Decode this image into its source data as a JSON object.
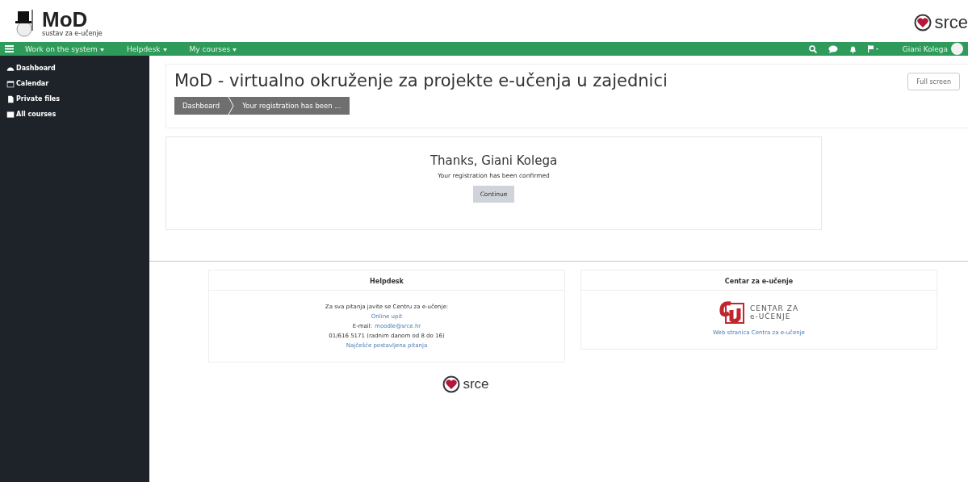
{
  "header": {
    "logo_title": "MoD",
    "logo_subtitle": "sustav za e-učenje",
    "partner_logo": "srce"
  },
  "navbar": {
    "menus": [
      {
        "label": "Work on the system"
      },
      {
        "label": "Helpdesk"
      },
      {
        "label": "My courses"
      }
    ],
    "user_name": "Giani Kolega"
  },
  "sidebar": {
    "items": [
      {
        "label": "Dashboard"
      },
      {
        "label": "Calendar"
      },
      {
        "label": "Private files"
      },
      {
        "label": "All courses"
      }
    ]
  },
  "page_header": {
    "title": "MoD - virtualno okruženje za projekte e-učenja u zajednici",
    "breadcrumbs": [
      "Dashboard",
      "Your registration has been ..."
    ],
    "full_screen_button": "Full screen"
  },
  "confirmation": {
    "heading": "Thanks, Giani Kolega",
    "message": "Your registration has been confirmed",
    "button": "Continue"
  },
  "footer": {
    "blocks": [
      {
        "title": "Helpdesk",
        "lines": [
          {
            "kind": "text",
            "text": "Za sva pitanja javite se Centru za e-učenje:"
          },
          {
            "kind": "link",
            "text": "Online upit"
          },
          {
            "kind": "mixed",
            "text": "E-mail:",
            "link": "moodle@srce.hr"
          },
          {
            "kind": "text",
            "text": "01/616 5171 (radnim danom od 8 do 16)"
          },
          {
            "kind": "link",
            "text": "Najčešće postavljena pitanja"
          }
        ]
      },
      {
        "title": "Centar za e-učenje",
        "logo_lines": [
          "CENTAR ZA",
          "e-UČENJE"
        ],
        "lines": [
          {
            "kind": "link",
            "text": "Web stranica Centra za e-učenje"
          }
        ]
      }
    ],
    "logo": "srce"
  }
}
